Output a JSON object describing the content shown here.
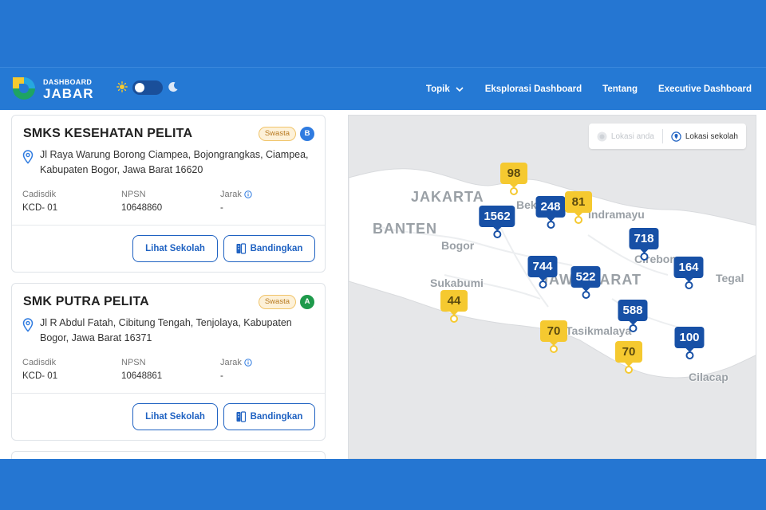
{
  "header": {
    "logo_top": "DASHBOARD",
    "logo_main": "JABAR",
    "nav": [
      {
        "label": "Topik",
        "has_dropdown": true
      },
      {
        "label": "Eksplorasi Dashboard"
      },
      {
        "label": "Tentang"
      },
      {
        "label": "Executive Dashboard"
      }
    ]
  },
  "schools": [
    {
      "name": "SMKS KESEHATAN PELITA",
      "type": "Swasta",
      "grade": "B",
      "grade_color": "#2f7be0",
      "address": "Jl Raya Warung Borong Ciampea, Bojongrangkas, Ciampea, Kabupaten Bogor, Jawa Barat 16620",
      "cadisdik_label": "Cadisdik",
      "cadisdik": "KCD- 01",
      "npsn_label": "NPSN",
      "npsn": "10648860",
      "jarak_label": "Jarak",
      "jarak": "-",
      "view_label": "Lihat Sekolah",
      "compare_label": "Bandingkan"
    },
    {
      "name": "SMK PUTRA PELITA",
      "type": "Swasta",
      "grade": "A",
      "grade_color": "#1e9a4b",
      "address": "Jl R Abdul Fatah, Cibitung Tengah, Tenjolaya, Kabupaten Bogor, Jawa Barat 16371",
      "cadisdik_label": "Cadisdik",
      "cadisdik": "KCD- 01",
      "npsn_label": "NPSN",
      "npsn": "10648861",
      "jarak_label": "Jarak",
      "jarak": "-",
      "view_label": "Lihat Sekolah",
      "compare_label": "Bandingkan"
    }
  ],
  "map": {
    "legend": {
      "my_location": "Lokasi anda",
      "school_location": "Lokasi sekolah"
    },
    "places": [
      "JAKARTA",
      "BANTEN",
      "Bogor",
      "Sukabumi",
      "Indramayu",
      "Cirebon",
      "Tegal",
      "Tasikmalaya",
      "Cilacap",
      "JAWA BARAT",
      "Bekasi"
    ],
    "markers": [
      {
        "value": "98",
        "color": "yellow"
      },
      {
        "value": "1562",
        "color": "blue"
      },
      {
        "value": "248",
        "color": "blue"
      },
      {
        "value": "81",
        "color": "yellow"
      },
      {
        "value": "718",
        "color": "blue"
      },
      {
        "value": "744",
        "color": "blue"
      },
      {
        "value": "522",
        "color": "blue"
      },
      {
        "value": "164",
        "color": "blue"
      },
      {
        "value": "44",
        "color": "yellow"
      },
      {
        "value": "588",
        "color": "blue"
      },
      {
        "value": "70",
        "color": "yellow"
      },
      {
        "value": "100",
        "color": "blue"
      },
      {
        "value": "70",
        "color": "yellow"
      }
    ]
  }
}
